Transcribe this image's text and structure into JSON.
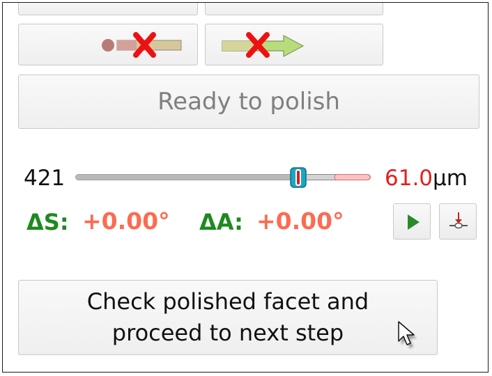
{
  "controls": {
    "ready_label": "Ready to polish",
    "slider": {
      "value_label": "421",
      "thickness_value": "61.0",
      "thickness_unit": "µm",
      "position": 0.755
    },
    "angles": {
      "s_label": "ΔS:",
      "s_value": "+0.00°",
      "a_label": "ΔA:",
      "a_value": "+0.00°"
    },
    "check_button": {
      "line1": "Check polished facet and",
      "line2": "proceed to next step"
    }
  },
  "icons": {
    "btn1": "disabled-start-arrow-icon",
    "btn2": "disabled-forward-arrow-icon",
    "play": "play-icon",
    "tool": "probe-tool-icon"
  },
  "colors": {
    "angle_label": "#1e8a1e",
    "angle_value": "#fb6c52",
    "thickness_value": "#e41f1f",
    "ready_text": "#7f7f7f"
  }
}
